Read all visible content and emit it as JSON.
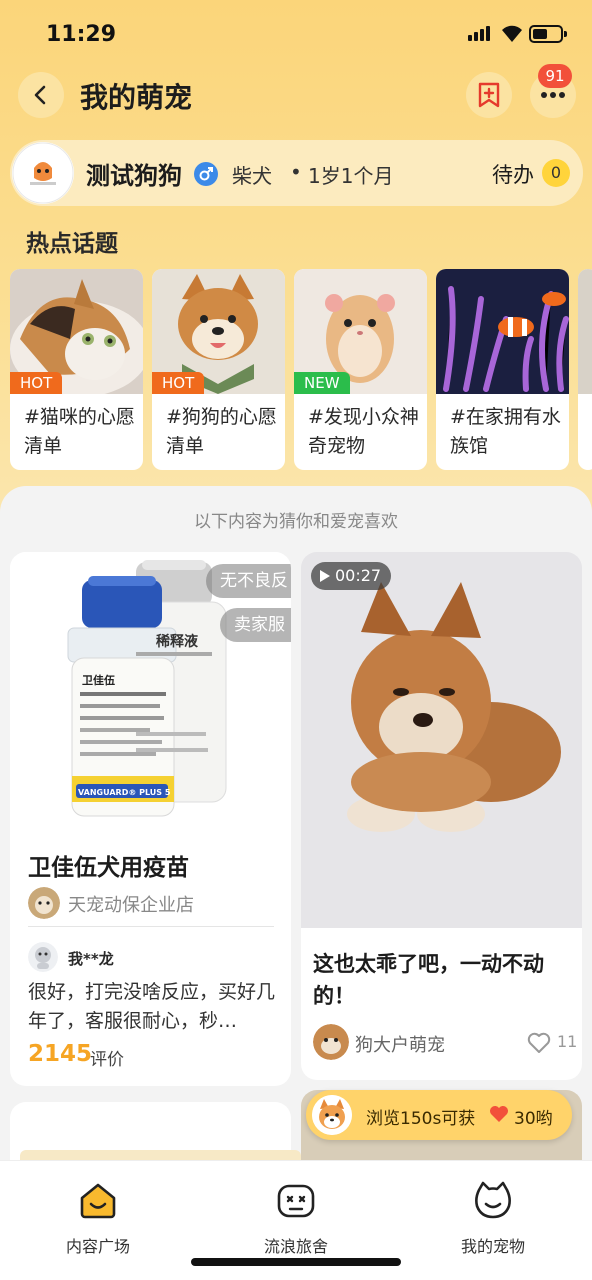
{
  "status_bar": {
    "time": "11:29"
  },
  "header": {
    "title": "我的萌宠",
    "notification_count": "91"
  },
  "pet": {
    "name": "测试狗狗",
    "breed": "柴犬",
    "separator": "•",
    "age": "1岁1个月",
    "todo_label": "待办",
    "todo_count": "0"
  },
  "hot_topics": {
    "title": "热点话题",
    "items": [
      {
        "tag": "HOT",
        "tag_type": "hot",
        "text": "#猫咪的心愿清单"
      },
      {
        "tag": "HOT",
        "tag_type": "hot",
        "text": "#狗狗的心愿清单"
      },
      {
        "tag": "NEW",
        "tag_type": "new",
        "text": "#发现小众神奇宠物"
      },
      {
        "tag": "",
        "tag_type": "none",
        "text": "#在家拥有水族馆"
      }
    ]
  },
  "feed": {
    "guess_text": "以下内容为猜你和爱宠喜欢",
    "product": {
      "pill_1": "无不良反",
      "pill_2": "卖家服",
      "vaccine_main_label": "卫佳伍",
      "vaccine_brand": "VANGUARD® PLUS 5",
      "vaccine_side_label": "稀释液",
      "title": "卫佳伍犬用疫苗",
      "shop": "天宠动保企业店",
      "reviewer": "我**龙",
      "review": "很好，打完没啥反应，买好几年了，客服很耐心，秒…",
      "review_count": "2145",
      "review_unit": "评价"
    },
    "video": {
      "duration": "00:27",
      "title": "这也太乖了吧，一动不动的！",
      "author": "狗大户萌宠",
      "likes": "11"
    }
  },
  "promo": {
    "text": "浏览150s可获",
    "amount": "30哟"
  },
  "bottom_nav": [
    {
      "label": "内容广场",
      "icon": "home-icon"
    },
    {
      "label": "流浪旅舍",
      "icon": "game-controller-icon"
    },
    {
      "label": "我的宠物",
      "icon": "pet-face-icon"
    }
  ],
  "colors": {
    "accent": "#f6a524",
    "header_bg": "#fbd57a",
    "hot": "#f06a1c",
    "new": "#2bbd4b",
    "badge": "#f2503a"
  }
}
